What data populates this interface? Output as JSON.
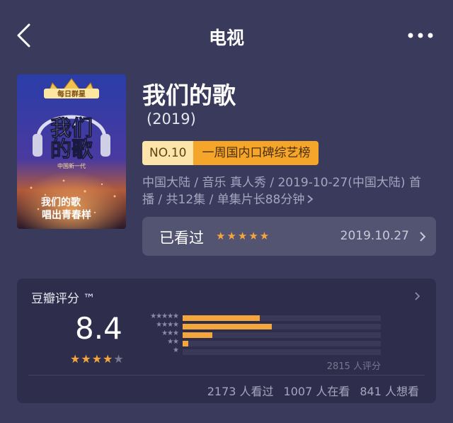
{
  "nav": {
    "title": "电视",
    "back_icon": "chevron-left-icon",
    "more_icon": "more-horizontal-icon"
  },
  "movie": {
    "title": "我们的歌",
    "year": "(2019)",
    "poster": {
      "top_banner": "每日群星",
      "logo_line1": "我们",
      "logo_line2": "的歌",
      "logo_sub": "中国新一代",
      "slogan_line1": "我们的歌",
      "slogan_line2": "唱出青春样"
    },
    "rank": {
      "number": "NO.10",
      "label": "一周国内口碑综艺榜"
    },
    "meta": "中国大陆 / 音乐 真人秀 / 2019-10-27(中国大陆) 首播 / 共12集 / 单集片长88分钟",
    "watched": {
      "label": "已看过",
      "user_stars": 5,
      "date": "2019.10.27"
    }
  },
  "rating": {
    "title": "豆瓣评分 ™",
    "score": "8.4",
    "stars": 4,
    "distribution": [
      {
        "stars": 5,
        "fraction": 0.39
      },
      {
        "stars": 4,
        "fraction": 0.45
      },
      {
        "stars": 3,
        "fraction": 0.15
      },
      {
        "stars": 2,
        "fraction": 0.03
      },
      {
        "stars": 1,
        "fraction": 0.0
      }
    ],
    "count": "2815 人评分",
    "stats": {
      "watched": "2173 人看过",
      "watching": "1007 人在看",
      "want": "841 人想看"
    }
  },
  "colors": {
    "background": "#3a3a5c",
    "accent": "#f3a63b",
    "rank_bg": "#f6a52b",
    "card_bg": "#2e2e4c"
  }
}
